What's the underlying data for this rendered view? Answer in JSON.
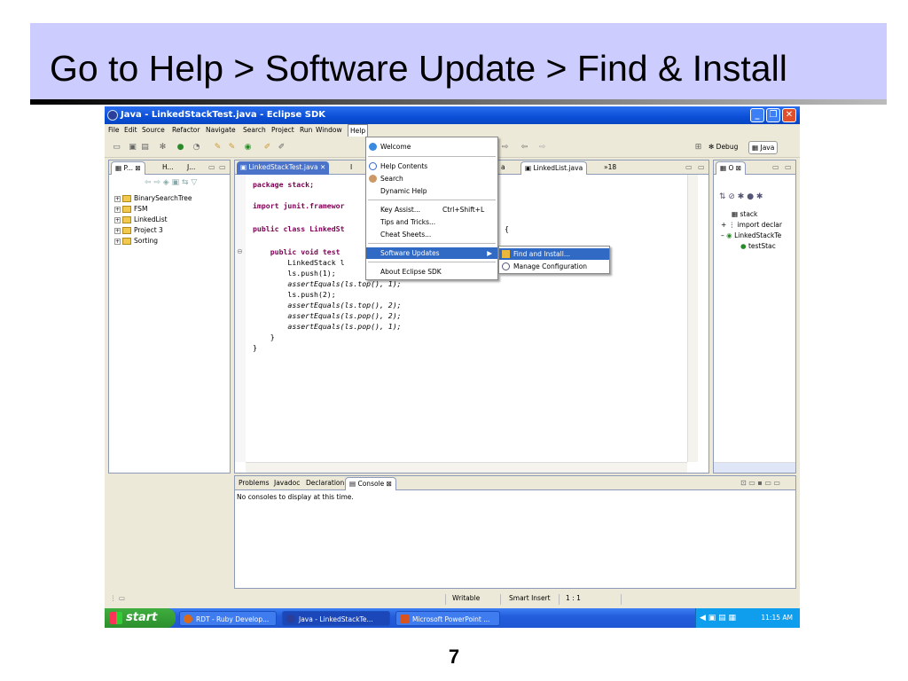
{
  "slide": {
    "title": "Go to Help > Software Update > Find & Install",
    "page_number": "7"
  },
  "window": {
    "title": "Java - LinkedStackTest.java - Eclipse SDK",
    "min": "_",
    "max": "❐",
    "close": "✕"
  },
  "menubar": [
    "File",
    "Edit",
    "Source",
    "Refactor",
    "Navigate",
    "Search",
    "Project",
    "Run",
    "Window",
    "Help"
  ],
  "perspectives": {
    "debug": "Debug",
    "java": "Java"
  },
  "left_panel": {
    "tabs": [
      "P...",
      "H...",
      "J..."
    ],
    "tree": [
      "BinarySearchTree",
      "FSM",
      "LinkedList",
      "Project 3",
      "Sorting"
    ]
  },
  "editor": {
    "tabs": [
      "LinkedStackTest.java",
      "I",
      "a",
      "LinkedList.java",
      "»18"
    ],
    "lines": [
      "package stack;",
      "",
      "import junit.framewor",
      "",
      "public class LinkedSt",
      "",
      "    public void test",
      "        LinkedStack l",
      "        ls.push(1);",
      "        assertEquals(ls.top(), 1);",
      "        ls.push(2);",
      "        assertEquals(ls.top(), 2);",
      "        assertEquals(ls.pop(), 2);",
      "        assertEquals(ls.pop(), 1);",
      "    }",
      "}"
    ],
    "brace_fragment": "{"
  },
  "help_menu": {
    "items": [
      {
        "label": "Welcome"
      },
      {
        "label": "Help Contents"
      },
      {
        "label": "Search"
      },
      {
        "label": "Dynamic Help"
      },
      {
        "label": "Key Assist...",
        "accel": "Ctrl+Shift+L"
      },
      {
        "label": "Tips and Tricks..."
      },
      {
        "label": "Cheat Sheets..."
      },
      {
        "label": "Software Updates"
      },
      {
        "label": "About Eclipse SDK"
      }
    ]
  },
  "submenu": {
    "items": [
      "Find and Install...",
      "Manage Configuration"
    ]
  },
  "outline": {
    "tab": "O",
    "items": [
      "stack",
      "import declar",
      "LinkedStackTe",
      "testStac"
    ]
  },
  "bottom_panel": {
    "tabs": [
      "Problems",
      "Javadoc",
      "Declaration",
      "Console"
    ],
    "message": "No consoles to display at this time."
  },
  "status": {
    "writable": "Writable",
    "insert_mode": "Smart Insert",
    "position": "1 : 1"
  },
  "taskbar": {
    "start": "start",
    "tasks": [
      "RDT - Ruby Develop...",
      "Java - LinkedStackTe...",
      "Microsoft PowerPoint ..."
    ],
    "clock": "11:15 AM"
  }
}
